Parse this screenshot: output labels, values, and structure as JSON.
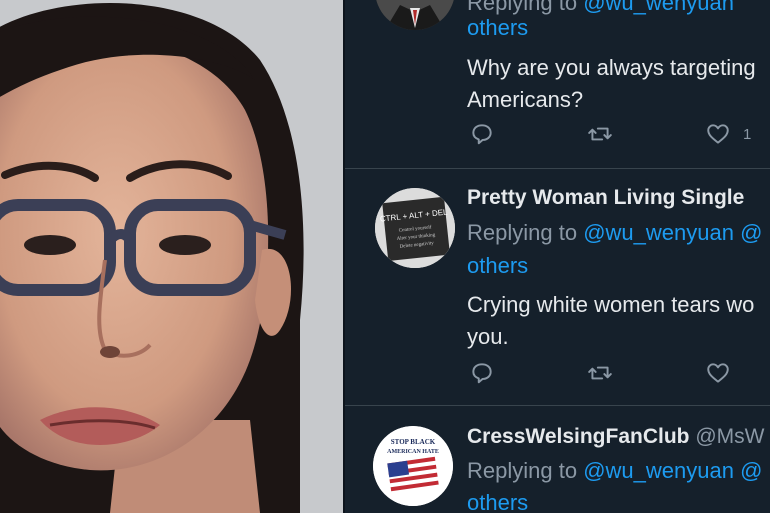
{
  "tweets": [
    {
      "reply_prefix": "Replying to ",
      "reply_handle": "@wu_wenyuan",
      "others": "others",
      "text_line1": "Why are you always targeting",
      "text_line2": "Americans?",
      "like_count": "1"
    },
    {
      "author": "Pretty Woman Living Single",
      "avatar_text": [
        "CTRL + ALT + DEL",
        "Control yourself",
        "Alter your thinking",
        "Delete negativity"
      ],
      "reply_prefix": "Replying to ",
      "reply_handle": "@wu_wenyuan",
      "reply_suffix": " @",
      "others": "others",
      "text_line1": "Crying white women tears wo",
      "text_line2": "you."
    },
    {
      "author": "CressWelsingFanClub",
      "handle": " @MsW",
      "avatar_text": [
        "STOP BLACK",
        "AMERICAN HATE"
      ],
      "reply_prefix": "Replying to ",
      "reply_handle": "@wu_wenyuan",
      "reply_suffix": " @",
      "others": "others"
    }
  ],
  "icons": {
    "reply": "reply-icon",
    "retweet": "retweet-icon",
    "like": "heart-icon"
  },
  "colors": {
    "background": "#15202b",
    "link": "#1d9bf0",
    "text": "#e6e9ec",
    "muted": "#8b98a5"
  }
}
